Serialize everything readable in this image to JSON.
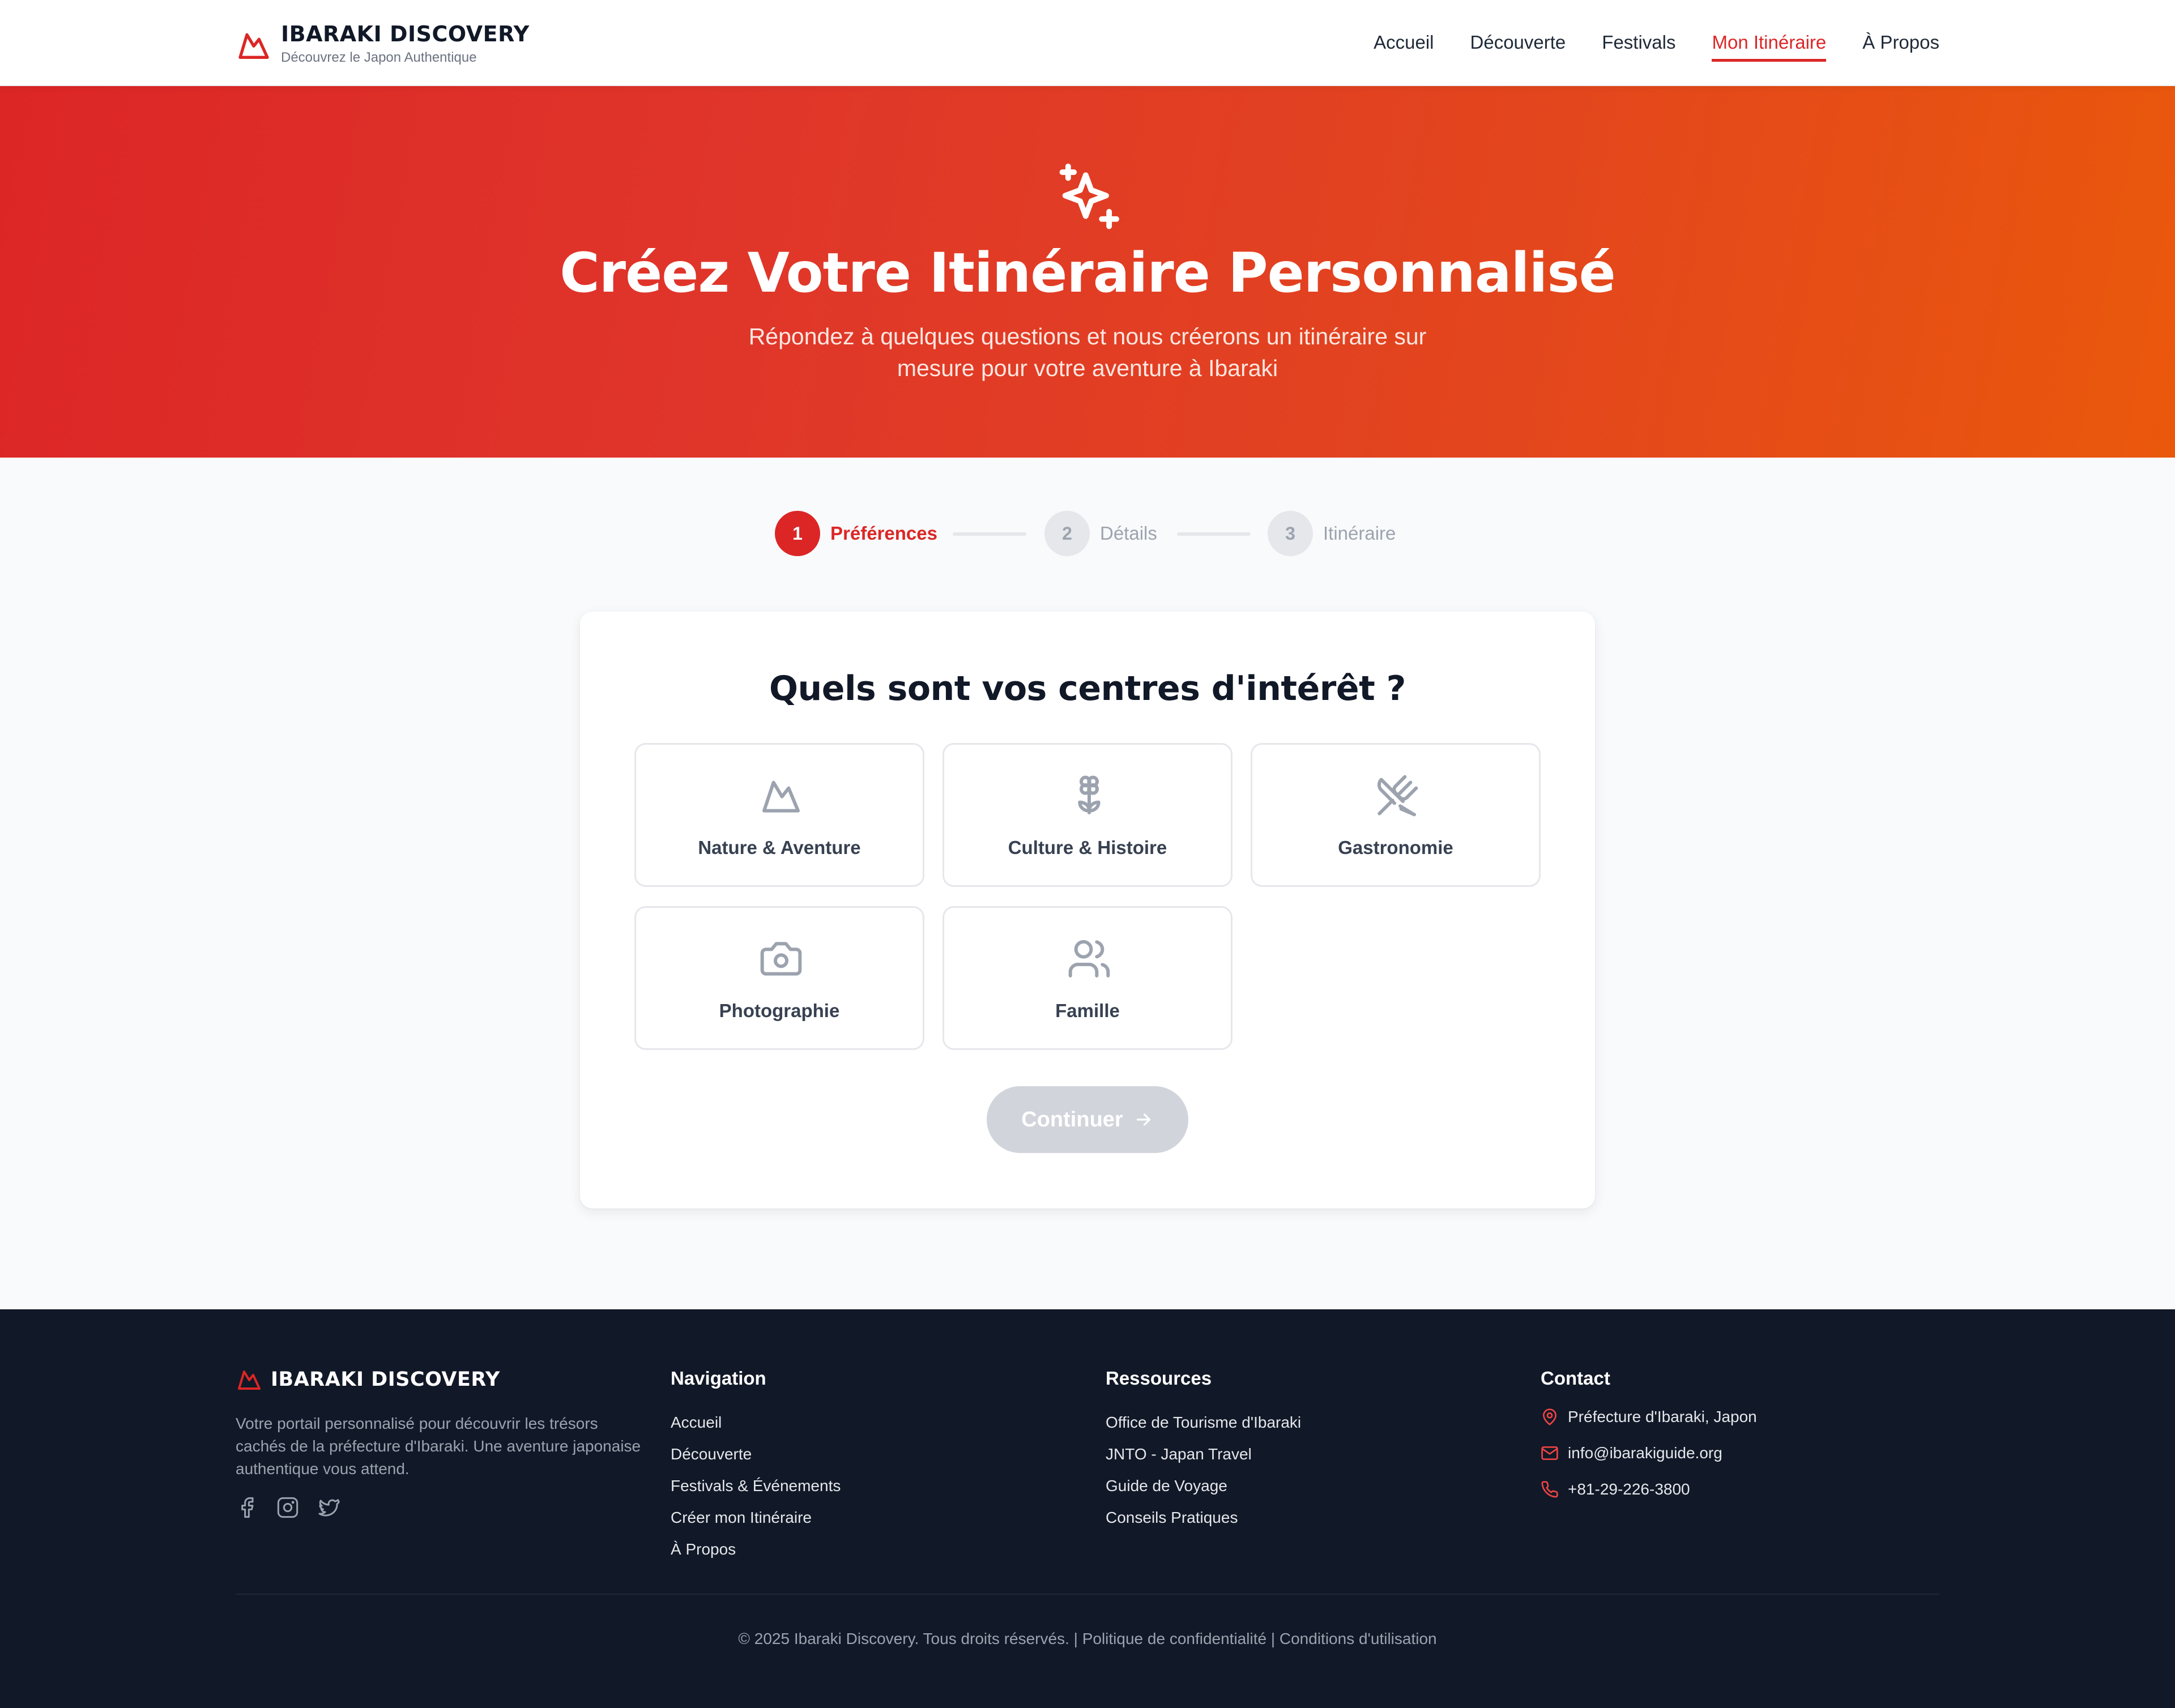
{
  "brand": {
    "title": "IBARAKI DISCOVERY",
    "subtitle": "Découvrez le Japon Authentique",
    "logo_icon": "mountain-icon",
    "accent_color": "#dc2626"
  },
  "nav": {
    "items": [
      {
        "label": "Accueil",
        "active": false
      },
      {
        "label": "Découverte",
        "active": false
      },
      {
        "label": "Festivals",
        "active": false
      },
      {
        "label": "Mon Itinéraire",
        "active": true
      },
      {
        "label": "À Propos",
        "active": false
      }
    ]
  },
  "hero": {
    "icon": "sparkles-icon",
    "title": "Créez Votre Itinéraire Personnalisé",
    "subtitle": "Répondez à quelques questions et nous créerons un itinéraire sur mesure pour votre aventure à Ibaraki",
    "gradient_start": "#dc2626",
    "gradient_end": "#ea580c"
  },
  "stepper": {
    "steps": [
      {
        "number": "1",
        "label": "Préférences",
        "state": "active"
      },
      {
        "number": "2",
        "label": "Détails",
        "state": "pending"
      },
      {
        "number": "3",
        "label": "Itinéraire",
        "state": "pending"
      }
    ]
  },
  "form": {
    "question": "Quels sont vos centres d'intérêt ?",
    "options": [
      {
        "label": "Nature & Aventure",
        "icon": "mountain-icon"
      },
      {
        "label": "Culture & Histoire",
        "icon": "flower-icon"
      },
      {
        "label": "Gastronomie",
        "icon": "utensils-crossed-icon"
      },
      {
        "label": "Photographie",
        "icon": "camera-icon"
      },
      {
        "label": "Famille",
        "icon": "users-icon"
      }
    ],
    "continue_label": "Continuer",
    "continue_icon": "arrow-right-icon",
    "continue_disabled": true
  },
  "footer": {
    "brand_title": "IBARAKI DISCOVERY",
    "description": "Votre portail personnalisé pour découvrir les trésors cachés de la préfecture d'Ibaraki. Une aventure japonaise authentique vous attend.",
    "social": [
      "facebook-icon",
      "instagram-icon",
      "twitter-icon"
    ],
    "navigation": {
      "title": "Navigation",
      "links": [
        "Accueil",
        "Découverte",
        "Festivals & Événements",
        "Créer mon Itinéraire",
        "À Propos"
      ]
    },
    "resources": {
      "title": "Ressources",
      "links": [
        "Office de Tourisme d'Ibaraki",
        "JNTO - Japan Travel",
        "Guide de Voyage",
        "Conseils Pratiques"
      ]
    },
    "contact": {
      "title": "Contact",
      "address": "Préfecture d'Ibaraki, Japon",
      "email": "info@ibarakiguide.org",
      "phone": "+81-29-226-3800"
    },
    "copyright": "© 2025 Ibaraki Discovery. Tous droits réservés.",
    "separator": "|",
    "privacy": "Politique de confidentialité",
    "terms": "Conditions d'utilisation",
    "background": "#111827"
  }
}
